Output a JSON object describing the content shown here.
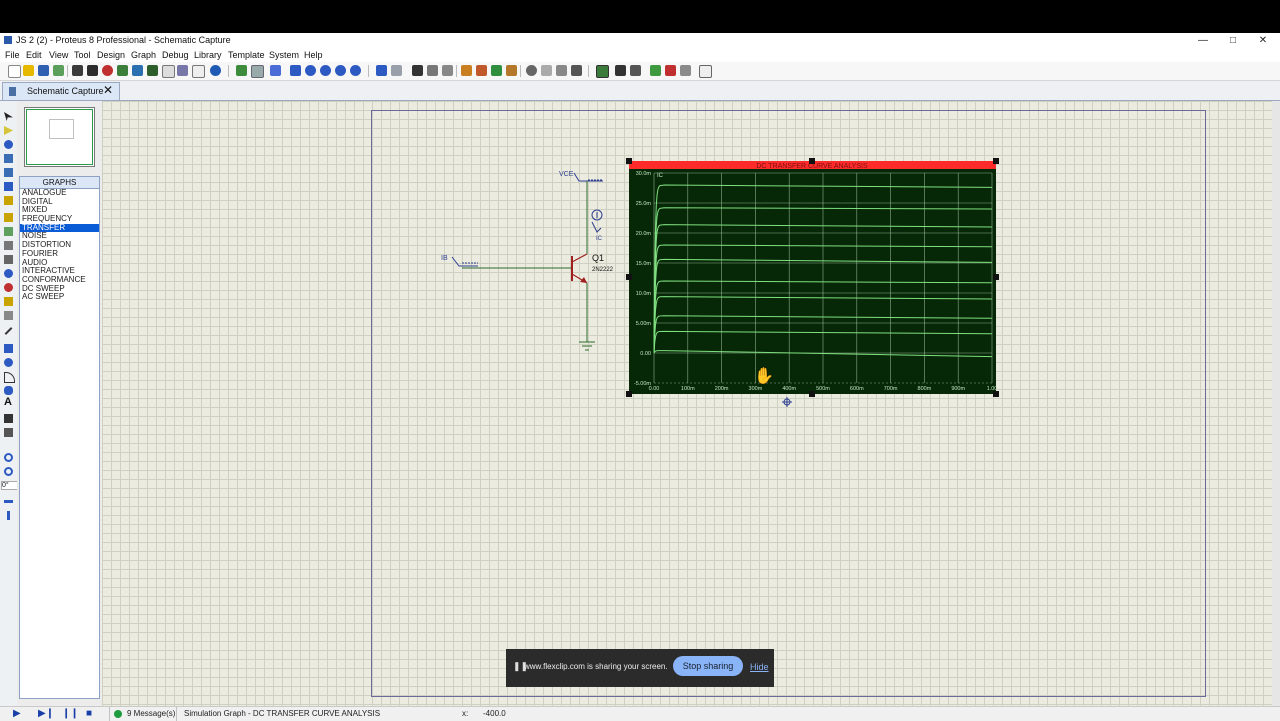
{
  "window": {
    "title": "JS 2 (2) - Proteus 8 Professional - Schematic Capture",
    "controls": [
      "—",
      "□",
      "✕"
    ]
  },
  "menu": [
    "File",
    "Edit",
    "View",
    "Tool",
    "Design",
    "Graph",
    "Debug",
    "Library",
    "Template",
    "System",
    "Help"
  ],
  "tab": {
    "label": "Schematic Capture",
    "close": "✕"
  },
  "panel": {
    "header": "GRAPHS",
    "items": [
      "ANALOGUE",
      "DIGITAL",
      "MIXED",
      "FREQUENCY",
      "TRANSFER",
      "NOISE",
      "DISTORTION",
      "FOURIER",
      "AUDIO",
      "INTERACTIVE",
      "CONFORMANCE",
      "DC SWEEP",
      "AC SWEEP"
    ],
    "selected": "TRANSFER"
  },
  "left_tools": {
    "rotation": "0°"
  },
  "schematic": {
    "vce_label": "VCE",
    "ib_label": "IB",
    "transistor_ref": "Q1",
    "transistor_part": "2N2222",
    "probe_label": "IC"
  },
  "graph": {
    "title": "DC TRANSFER CURVE ANALYSIS",
    "trace_name": "IC",
    "colors": {
      "background": "#072807",
      "grid": "#bfe6bf",
      "trace": "#7fe07f",
      "title_bar": "#ff2b2b"
    }
  },
  "chart_data": {
    "type": "line",
    "title": "DC TRANSFER CURVE ANALYSIS",
    "y_tick_labels": [
      "30.0m",
      "25.0m",
      "20.0m",
      "15.0m",
      "10.0m",
      "5.00m",
      "0.00",
      "-5.00m"
    ],
    "x_tick_labels": [
      "0.00",
      "100m",
      "200m",
      "300m",
      "400m",
      "500m",
      "600m",
      "700m",
      "800m",
      "900m",
      "1.00"
    ],
    "xlim": [
      0,
      1.0
    ],
    "ylim": [
      -5,
      30
    ],
    "y_unit": "mA",
    "grid": true,
    "series": [
      {
        "saturation_mA": 28.0,
        "end_mA": 27.6
      },
      {
        "saturation_mA": 24.2,
        "end_mA": 24.0
      },
      {
        "saturation_mA": 21.4,
        "end_mA": 21.0
      },
      {
        "saturation_mA": 18.0,
        "end_mA": 17.7
      },
      {
        "saturation_mA": 15.6,
        "end_mA": 15.1
      },
      {
        "saturation_mA": 12.0,
        "end_mA": 11.7
      },
      {
        "saturation_mA": 9.4,
        "end_mA": 9.0
      },
      {
        "saturation_mA": 6.2,
        "end_mA": 5.8
      },
      {
        "saturation_mA": 3.6,
        "end_mA": 3.2
      },
      {
        "saturation_mA": 0.4,
        "end_mA": -0.6
      }
    ]
  },
  "status": {
    "messages": "9 Message(s)",
    "info": "Simulation Graph - DC TRANSFER CURVE ANALYSIS",
    "coord_label": "x:",
    "coord_value": "-400.0"
  },
  "share": {
    "message": "www.flexclip.com is sharing your screen.",
    "stop_label": "Stop sharing",
    "hide_label": "Hide",
    "pause_icon": "❚❚"
  }
}
